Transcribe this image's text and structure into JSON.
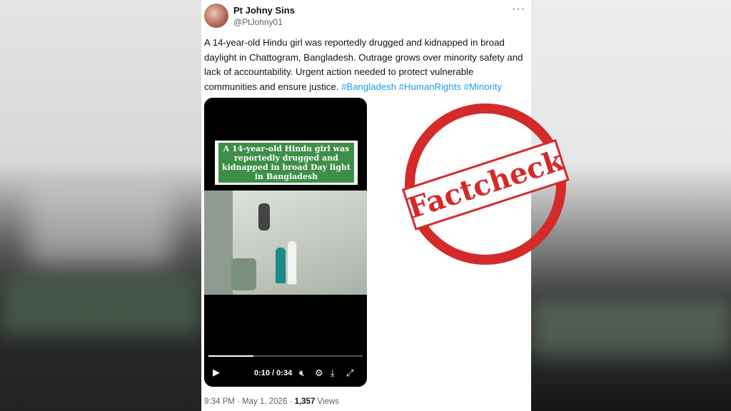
{
  "tweet": {
    "name": "Pt Johny Sins",
    "handle": "@PtJohny01",
    "more": "···",
    "text": "A 14-year-old Hindu girl was reportedly drugged and kidnapped in broad daylight in Chattogram, Bangladesh. Outrage grows over minority safety and lack of accountability. Urgent action needed to protect vulnerable communities and ensure justice.",
    "hashtags": "#Bangladesh #HumanRights #Minority",
    "time": "9:34 PM · May 1, 2026 · ",
    "views_count": "1,357",
    "views_label": "Views"
  },
  "video": {
    "caption": "A 14-year-old Hindu girl was reportedly drugged and kidnapped in broad Day light in Bangladesh",
    "time_display": "0:10 / 0:34",
    "progress_fraction": 0.29
  },
  "stamp": {
    "text": "Factcheck",
    "color": "#d42a2a"
  },
  "colors": {
    "link": "#1d9bf0",
    "text": "#0f1419",
    "secondary": "#536471"
  }
}
